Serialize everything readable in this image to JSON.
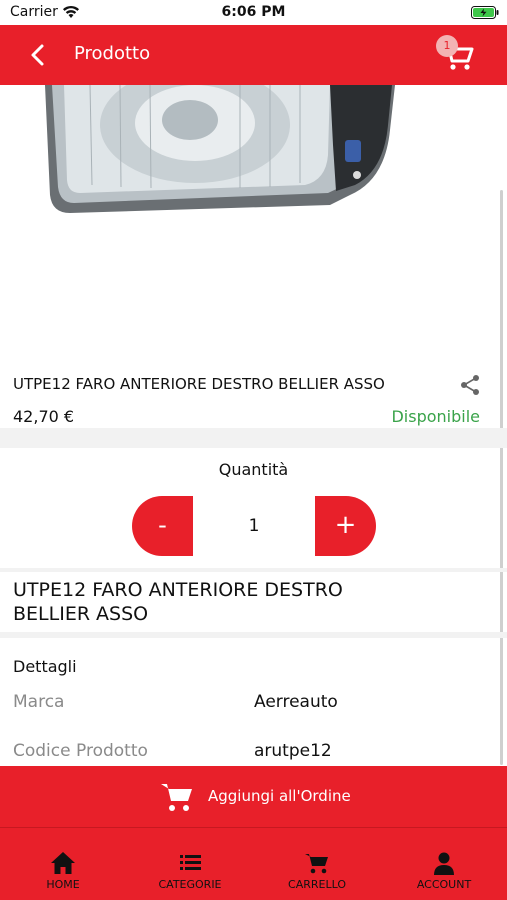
{
  "status_bar": {
    "carrier": "Carrier",
    "time": "6:06 PM"
  },
  "nav": {
    "title": "Prodotto",
    "cart_count": "1"
  },
  "product": {
    "name": "UTPE12 FARO ANTERIORE DESTRO BELLIER ASSO",
    "name_big_line1": "UTPE12 FARO ANTERIORE DESTRO",
    "name_big_line2": "BELLIER ASSO",
    "price": "42,70 €",
    "availability": "Disponibile"
  },
  "quantity": {
    "label": "Quantità",
    "value": "1",
    "minus": "-",
    "plus": "+"
  },
  "details": {
    "heading": "Dettagli",
    "rows": [
      {
        "label": "Marca",
        "value": "Aerreauto"
      },
      {
        "label": "Codice Prodotto",
        "value": "arutpe12"
      }
    ]
  },
  "add_to_order": {
    "label": "Aggiungi all'Ordine"
  },
  "tabs": [
    {
      "label": "HOME",
      "icon": "home-icon"
    },
    {
      "label": "CATEGORIE",
      "icon": "list-icon"
    },
    {
      "label": "CARRELLO",
      "icon": "cart-icon"
    },
    {
      "label": "ACCOUNT",
      "icon": "user-icon"
    }
  ],
  "colors": {
    "primary": "#e8202a",
    "available": "#3aa34a",
    "muted": "#8a8a8a"
  }
}
